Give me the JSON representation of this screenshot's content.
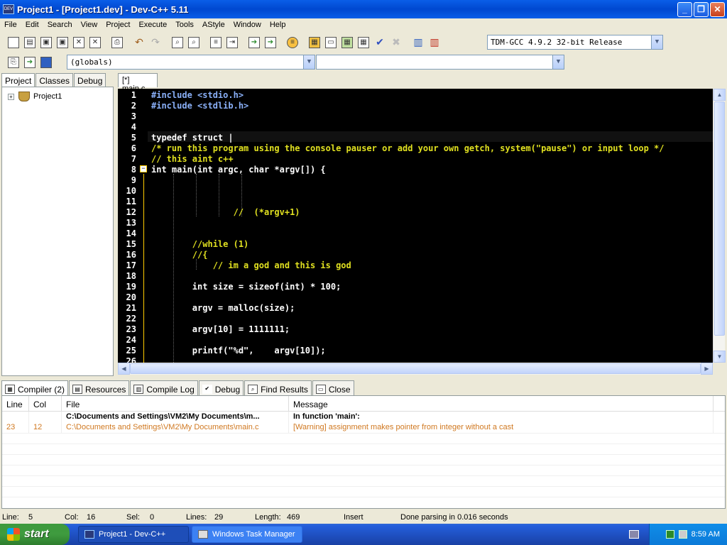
{
  "window": {
    "title": "Project1 - [Project1.dev] - Dev-C++ 5.11",
    "icon_text": "DEV"
  },
  "menu": [
    "File",
    "Edit",
    "Search",
    "View",
    "Project",
    "Execute",
    "Tools",
    "AStyle",
    "Window",
    "Help"
  ],
  "compiler_combo": "TDM-GCC 4.9.2 32-bit Release",
  "globals_combo": "(globals)",
  "left_tabs": [
    "Project",
    "Classes",
    "Debug"
  ],
  "project_tree": {
    "root": "Project1"
  },
  "editor_tab": "[*] main.c",
  "code_lines": [
    {
      "n": "1",
      "text": "#include <stdio.h>",
      "cls": "c-pre"
    },
    {
      "n": "2",
      "text": "#include <stdlib.h>",
      "cls": "c-pre"
    },
    {
      "n": "3",
      "text": "",
      "cls": "c-kw"
    },
    {
      "n": "4",
      "text": "",
      "cls": "c-kw"
    },
    {
      "n": "5",
      "text": "typedef struct |",
      "cls": "c-kw"
    },
    {
      "n": "6",
      "text": "/* run this program using the console pauser or add your own getch, system(\"pause\") or input loop */",
      "cls": "c-cm"
    },
    {
      "n": "7",
      "text": "// this aint c++",
      "cls": "c-cm"
    },
    {
      "n": "8",
      "text": "int main(int argc, char *argv[]) {",
      "cls": "c-kw"
    },
    {
      "n": "9",
      "text": "",
      "cls": "c-kw"
    },
    {
      "n": "10",
      "text": "",
      "cls": "c-kw"
    },
    {
      "n": "11",
      "text": "",
      "cls": "c-kw"
    },
    {
      "n": "12",
      "text": "                //  (*argv+1)",
      "cls": "c-cm"
    },
    {
      "n": "13",
      "text": "",
      "cls": "c-kw"
    },
    {
      "n": "14",
      "text": "",
      "cls": "c-kw"
    },
    {
      "n": "15",
      "text": "        //while (1)",
      "cls": "c-cm"
    },
    {
      "n": "16",
      "text": "        //{",
      "cls": "c-cm"
    },
    {
      "n": "17",
      "text": "            // im a god and this is god",
      "cls": "c-cm"
    },
    {
      "n": "18",
      "text": "",
      "cls": "c-kw"
    },
    {
      "n": "19",
      "text": "        int size = sizeof(int) * 100;",
      "cls": "c-kw"
    },
    {
      "n": "20",
      "text": "",
      "cls": "c-kw"
    },
    {
      "n": "21",
      "text": "        argv = malloc(size);",
      "cls": "c-kw"
    },
    {
      "n": "22",
      "text": "",
      "cls": "c-kw"
    },
    {
      "n": "23",
      "text": "        argv[10] = 1111111;",
      "cls": "c-kw"
    },
    {
      "n": "24",
      "text": "",
      "cls": "c-kw"
    },
    {
      "n": "25",
      "text": "        printf(\"%d\",    argv[10]);",
      "cls": "c-kw"
    },
    {
      "n": "26",
      "text": "",
      "cls": "c-kw"
    }
  ],
  "bottom_tabs": [
    "Compiler (2)",
    "Resources",
    "Compile Log",
    "Debug",
    "Find Results",
    "Close"
  ],
  "messages": {
    "headers": [
      "Line",
      "Col",
      "File",
      "Message"
    ],
    "rows": [
      {
        "line": "",
        "col": "",
        "file": "C:\\Documents and Settings\\VM2\\My Documents\\m...",
        "message": "In function 'main':",
        "style": "bold"
      },
      {
        "line": "23",
        "col": "12",
        "file": "C:\\Documents and Settings\\VM2\\My Documents\\main.c",
        "message": "[Warning] assignment makes pointer from integer without a cast",
        "style": "warn"
      }
    ]
  },
  "status": {
    "line_label": "Line:",
    "line": "5",
    "col_label": "Col:",
    "col": "16",
    "sel_label": "Sel:",
    "sel": "0",
    "lines_label": "Lines:",
    "lines": "29",
    "length_label": "Length:",
    "length": "469",
    "mode": "Insert",
    "message": "Done parsing in 0.016 seconds"
  },
  "taskbar": {
    "start": "start",
    "items": [
      "Project1 - Dev-C++",
      "Windows Task Manager"
    ],
    "clock": "8:59 AM"
  }
}
